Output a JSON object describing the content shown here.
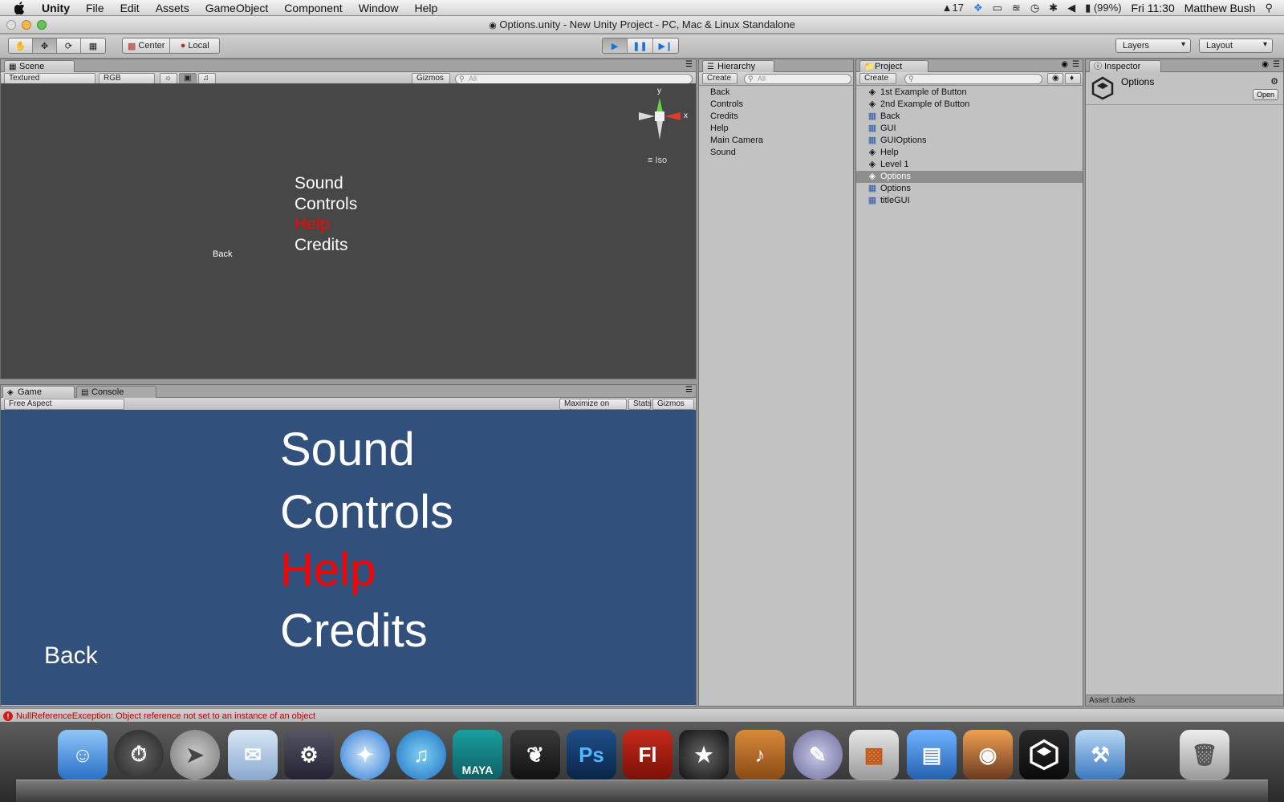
{
  "menubar": {
    "app": "Unity",
    "items": [
      "File",
      "Edit",
      "Assets",
      "GameObject",
      "Component",
      "Window",
      "Help"
    ],
    "status_num": "17",
    "battery": "(99%)",
    "clock": "Fri 11:30",
    "user": "Matthew Bush"
  },
  "window": {
    "title": "Options.unity - New Unity Project - PC, Mac & Linux Standalone"
  },
  "toolbar": {
    "center": "Center",
    "local": "Local",
    "layers": "Layers",
    "layout": "Layout"
  },
  "scene": {
    "tab": "Scene",
    "render_mode": "Textured",
    "color_mode": "RGB",
    "gizmos": "Gizmos",
    "search_placeholder": "All",
    "axis_y": "y",
    "axis_x": "x",
    "iso": "Iso",
    "menu": [
      "Sound",
      "Controls",
      "Help",
      "Credits"
    ],
    "back": "Back"
  },
  "game": {
    "tab": "Game",
    "console_tab": "Console",
    "aspect": "Free Aspect",
    "maximize": "Maximize on Play",
    "stats": "Stats",
    "gizmos": "Gizmos",
    "menu": [
      "Sound",
      "Controls",
      "Help",
      "Credits"
    ],
    "back": "Back",
    "highlight_color": "#ff0000"
  },
  "hierarchy": {
    "tab": "Hierarchy",
    "create": "Create",
    "search_placeholder": "All",
    "items": [
      "Back",
      "Controls",
      "Credits",
      "Help",
      "Main Camera",
      "Sound"
    ]
  },
  "project": {
    "tab": "Project",
    "create": "Create",
    "items": [
      {
        "icon": "unity",
        "label": "1st Example of Button"
      },
      {
        "icon": "unity",
        "label": "2nd Example of Button"
      },
      {
        "icon": "js",
        "label": "Back"
      },
      {
        "icon": "js",
        "label": "GUI"
      },
      {
        "icon": "js",
        "label": "GUIOptions"
      },
      {
        "icon": "unity",
        "label": "Help"
      },
      {
        "icon": "unity",
        "label": "Level 1"
      },
      {
        "icon": "unity",
        "label": "Options"
      },
      {
        "icon": "js",
        "label": "Options"
      },
      {
        "icon": "js",
        "label": "titleGUI"
      }
    ],
    "selected_index": 7
  },
  "inspector": {
    "tab": "Inspector",
    "title": "Options",
    "open": "Open",
    "asset_labels": "Asset Labels"
  },
  "status": {
    "message": "NullReferenceException: Object reference not set to an instance of an object"
  },
  "dock": {
    "maya_label": "MAYA",
    "ps_label": "Ps",
    "fl_label": "Fl"
  }
}
